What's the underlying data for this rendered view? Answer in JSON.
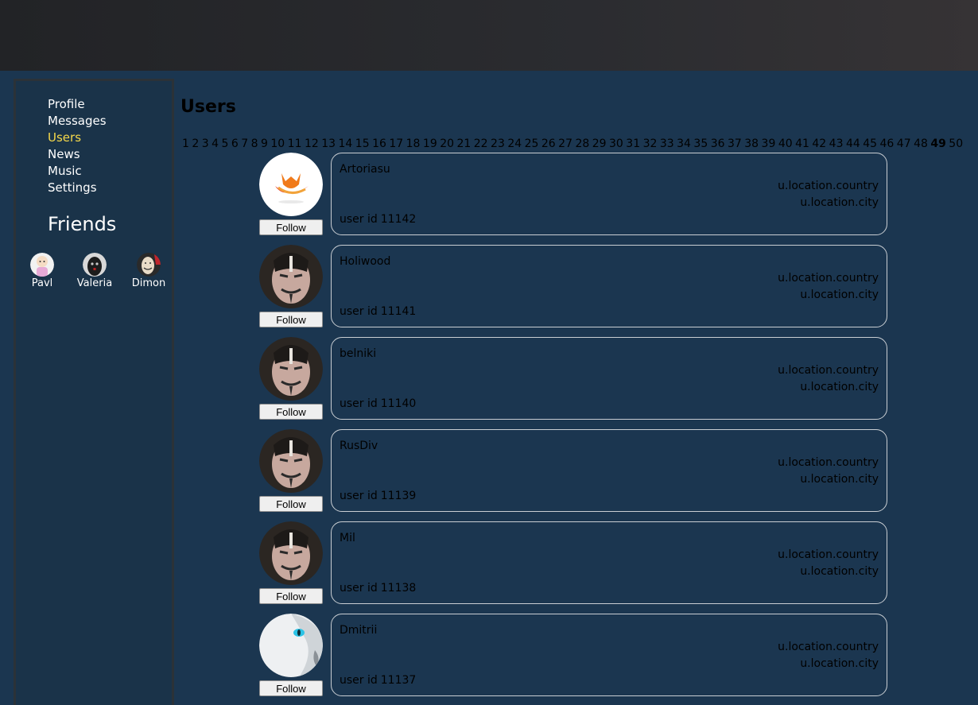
{
  "nav": {
    "items": [
      {
        "label": "Profile"
      },
      {
        "label": "Messages"
      },
      {
        "label": "Users"
      },
      {
        "label": "News"
      },
      {
        "label": "Music"
      },
      {
        "label": "Settings"
      }
    ],
    "active": "Users"
  },
  "friends": {
    "title": "Friends",
    "list": [
      {
        "name": "Pavl"
      },
      {
        "name": "Valeria"
      },
      {
        "name": "Dimon"
      }
    ]
  },
  "main": {
    "title": "Users",
    "pages": [
      "1",
      "2",
      "3",
      "4",
      "5",
      "6",
      "7",
      "8",
      "9",
      "10",
      "11",
      "12",
      "13",
      "14",
      "15",
      "16",
      "17",
      "18",
      "19",
      "20",
      "21",
      "22",
      "23",
      "24",
      "25",
      "26",
      "27",
      "28",
      "29",
      "30",
      "31",
      "32",
      "33",
      "34",
      "35",
      "36",
      "37",
      "38",
      "39",
      "40",
      "41",
      "42",
      "43",
      "44",
      "45",
      "46",
      "47",
      "48",
      "49",
      "50"
    ],
    "current_page": "49",
    "follow_label": "Follow",
    "users": [
      {
        "name": "Artoriasu",
        "country": "u.location.country",
        "city": "u.location.city",
        "id_label": "user id",
        "id": "11142",
        "avatar": "fox-avatar"
      },
      {
        "name": "Holiwood",
        "country": "u.location.country",
        "city": "u.location.city",
        "id_label": "user id",
        "id": "11141",
        "avatar": "mask-avatar"
      },
      {
        "name": "belniki",
        "country": "u.location.country",
        "city": "u.location.city",
        "id_label": "user id",
        "id": "11140",
        "avatar": "mask-avatar"
      },
      {
        "name": "RusDiv",
        "country": "u.location.country",
        "city": "u.location.city",
        "id_label": "user id",
        "id": "11139",
        "avatar": "mask-avatar"
      },
      {
        "name": "Mil",
        "country": "u.location.country",
        "city": "u.location.city",
        "id_label": "user id",
        "id": "11138",
        "avatar": "mask-avatar"
      },
      {
        "name": "Dmitrii",
        "country": "u.location.country",
        "city": "u.location.city",
        "id_label": "user id",
        "id": "11137",
        "avatar": "white-cat-avatar"
      }
    ]
  }
}
